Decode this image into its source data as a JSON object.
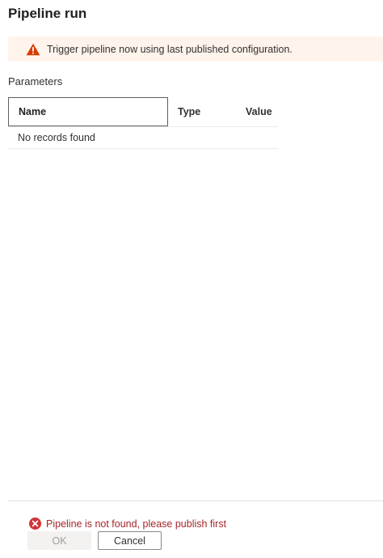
{
  "dialog": {
    "title": "Pipeline run"
  },
  "warning": {
    "icon": "warning-triangle-icon",
    "color": "#d83b01",
    "text": "Trigger pipeline now using last published configuration."
  },
  "parameters": {
    "label": "Parameters",
    "columns": [
      "Name",
      "Type",
      "Value"
    ],
    "empty_text": "No records found"
  },
  "error": {
    "icon": "error-circle-icon",
    "color": "#d13438",
    "text": "Pipeline is not found, please publish first"
  },
  "buttons": {
    "ok_label": "OK",
    "cancel_label": "Cancel"
  }
}
